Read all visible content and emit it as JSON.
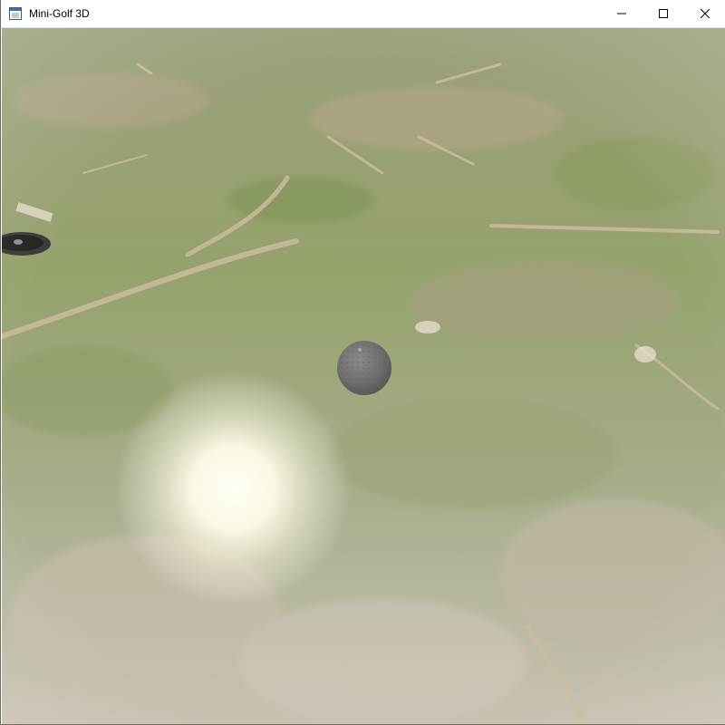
{
  "window": {
    "title": "Mini-Golf 3D",
    "app_icon": "app-window-icon",
    "controls": {
      "minimize": "minimize-icon",
      "maximize": "maximize-icon",
      "close": "close-icon"
    }
  },
  "scene": {
    "surface": "grass-and-dirt-ground",
    "objects": [
      "golf-ball",
      "hole-cup",
      "light-glare"
    ],
    "colors": {
      "grass": "#8f9f6a",
      "ball": "#6e6e6e",
      "hole": "#2a2a2a",
      "glare": "#fffbe8"
    }
  }
}
